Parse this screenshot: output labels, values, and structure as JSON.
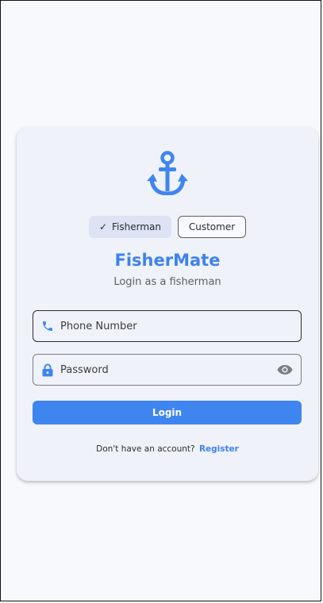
{
  "roles": {
    "fisherman_label": "Fisherman",
    "customer_label": "Customer",
    "selected": "Fisherman"
  },
  "app": {
    "title": "FisherMate",
    "subtitle": "Login as a fisherman"
  },
  "form": {
    "phone_placeholder": "Phone Number",
    "phone_value": "",
    "password_placeholder": "Password",
    "password_value": "",
    "login_label": "Login"
  },
  "footer": {
    "prompt": "Don't have an account?",
    "register_label": "Register"
  },
  "icons": {
    "logo": "anchor-icon",
    "selected_check": "check-icon",
    "phone": "phone-icon",
    "password": "lock-icon",
    "toggle_password": "eye-icon"
  },
  "colors": {
    "accent": "#3f85f0",
    "title": "#3d82ee",
    "card_background": "#f0f2f9",
    "selected_chip": "#dde3f4"
  }
}
